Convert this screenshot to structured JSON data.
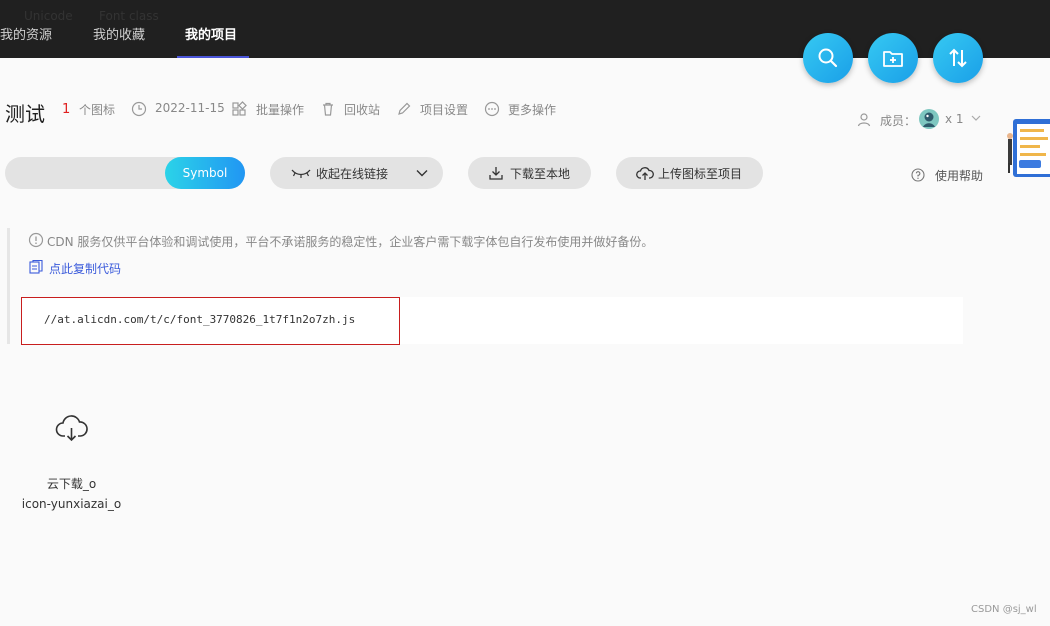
{
  "nav": {
    "tabs": [
      {
        "label": "我的资源"
      },
      {
        "label": "我的收藏"
      },
      {
        "label": "我的项目",
        "active": true
      }
    ]
  },
  "fabs": [
    {
      "icon": "search-icon"
    },
    {
      "icon": "folder-add-icon"
    },
    {
      "icon": "sort-icon"
    }
  ],
  "project": {
    "title": "测试",
    "icon_count": "1",
    "icon_count_suffix": "个图标",
    "date": "2022-11-15",
    "actions": {
      "batch": "批量操作",
      "recycle": "回收站",
      "settings": "项目设置",
      "more": "更多操作"
    },
    "members_label": "成员：",
    "members_count": "x 1"
  },
  "format_tabs": {
    "unicode": "Unicode",
    "font_class": "Font class",
    "symbol": "Symbol",
    "selected": "Symbol"
  },
  "toolbar": {
    "collapse_link": "收起在线链接",
    "download": "下载至本地",
    "upload": "上传图标至项目",
    "help": "使用帮助"
  },
  "notice": {
    "text": "CDN 服务仅供平台体验和调试使用，平台不承诺服务的稳定性，企业客户需下载字体包自行发布使用并做好备份。",
    "copy": "点此复制代码",
    "code": "//at.alicdn.com/t/c/font_3770826_1t7f1n2o7zh.js"
  },
  "icons": [
    {
      "name": "云下载_o",
      "code": "icon-yunxiazai_o",
      "glyph": "cloud-download-icon"
    }
  ],
  "colors": {
    "topbar": "#202020",
    "accent_gradient_start": "#2bd3e8",
    "accent_gradient_end": "#2196f3",
    "count_red": "#e02020",
    "link_blue": "#3b5bdb",
    "code_outline": "#c81e1e"
  },
  "watermark": "CSDN @sj_wl"
}
